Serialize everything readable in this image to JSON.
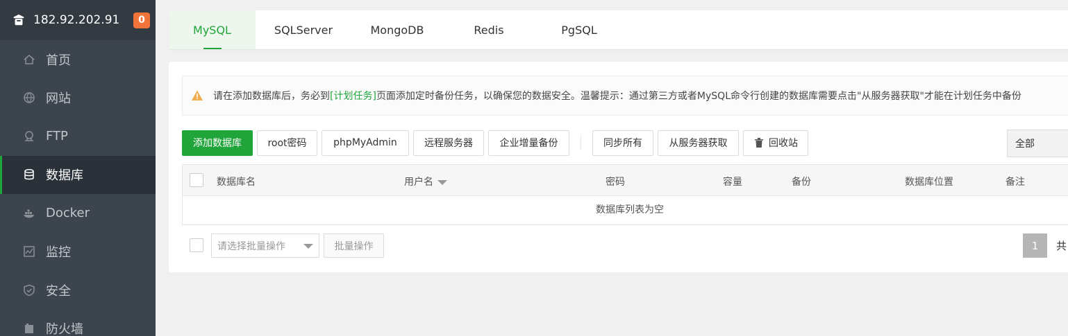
{
  "sidebar": {
    "server_ip": "182.92.202.91",
    "notification_count": "0",
    "items": [
      {
        "label": "首页",
        "icon": "home-icon"
      },
      {
        "label": "网站",
        "icon": "globe-icon"
      },
      {
        "label": "FTP",
        "icon": "ftp-icon"
      },
      {
        "label": "数据库",
        "icon": "database-icon",
        "active": true
      },
      {
        "label": "Docker",
        "icon": "docker-icon"
      },
      {
        "label": "监控",
        "icon": "monitor-icon"
      },
      {
        "label": "安全",
        "icon": "shield-icon"
      },
      {
        "label": "防火墙",
        "icon": "firewall-icon"
      }
    ]
  },
  "tabs": [
    {
      "label": "MySQL",
      "active": true
    },
    {
      "label": "SQLServer"
    },
    {
      "label": "MongoDB"
    },
    {
      "label": "Redis"
    },
    {
      "label": "PgSQL"
    }
  ],
  "alert": {
    "before": "请在添加数据库后，务必到",
    "link": "[计划任务]",
    "after": "页面添加定时备份任务，以确保您的数据安全。温馨提示：通过第三方或者MySQL命令行创建的数据库需要点击\"从服务器获取\"才能在计划任务中备份"
  },
  "toolbar": {
    "add_db": "添加数据库",
    "root_pwd": "root密码",
    "phpmyadmin": "phpMyAdmin",
    "remote_server": "远程服务器",
    "enterprise_backup": "企业增量备份",
    "sync_all": "同步所有",
    "fetch_from_server": "从服务器获取",
    "recycle_bin": "回收站",
    "filter_value": "全部"
  },
  "table": {
    "columns": [
      "数据库名",
      "用户名",
      "密码",
      "容量",
      "备份",
      "数据库位置",
      "备注"
    ],
    "empty_text": "数据库列表为空"
  },
  "footer": {
    "batch_placeholder": "请选择批量操作",
    "batch_button": "批量操作",
    "current_page": "1",
    "total_label": "共"
  },
  "colors": {
    "accent": "#20a53a",
    "sidebar_bg": "#3c444d",
    "badge": "#f0743a"
  }
}
